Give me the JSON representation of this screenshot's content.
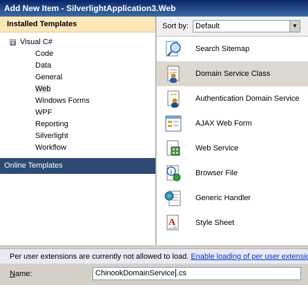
{
  "window": {
    "title": "Add New Item - SilverlightApplication3.Web"
  },
  "sidebar": {
    "header": "Installed Templates",
    "root": {
      "expander": "⊟",
      "label": "Visual C#"
    },
    "children": [
      {
        "label": "Code"
      },
      {
        "label": "Data"
      },
      {
        "label": "General"
      },
      {
        "label": "Web"
      },
      {
        "label": "Windows Forms"
      },
      {
        "label": "WPF"
      },
      {
        "label": "Reporting"
      },
      {
        "label": "Silverlight"
      },
      {
        "label": "Workflow"
      }
    ],
    "selected": "Web",
    "online_templates": "Online Templates"
  },
  "sort": {
    "label": "Sort by:",
    "value": "Default"
  },
  "templates": [
    {
      "label": "Search Sitemap",
      "icon": "search-sitemap-icon"
    },
    {
      "label": "Domain Service Class",
      "icon": "domain-service-icon"
    },
    {
      "label": "Authentication Domain Service",
      "icon": "authentication-domain-service-icon"
    },
    {
      "label": "AJAX Web Form",
      "icon": "ajax-web-form-icon"
    },
    {
      "label": "Web Service",
      "icon": "web-service-icon"
    },
    {
      "label": "Browser File",
      "icon": "browser-file-icon"
    },
    {
      "label": "Generic Handler",
      "icon": "generic-handler-icon"
    },
    {
      "label": "Style Sheet",
      "icon": "style-sheet-icon"
    }
  ],
  "selected_template": "Domain Service Class",
  "extensions": {
    "message": "Per user extensions are currently not allowed to load.",
    "link": "Enable loading of per user extensio"
  },
  "name_field": {
    "label_first": "N",
    "label_rest": "ame:",
    "value_before": "ChinookDomainService",
    "value_after": ".cs"
  },
  "colors": {
    "title_bar": "#0a246a",
    "header_bg": "#fde6b7",
    "online_bg": "#2d4b75",
    "link": "#0033cc"
  }
}
